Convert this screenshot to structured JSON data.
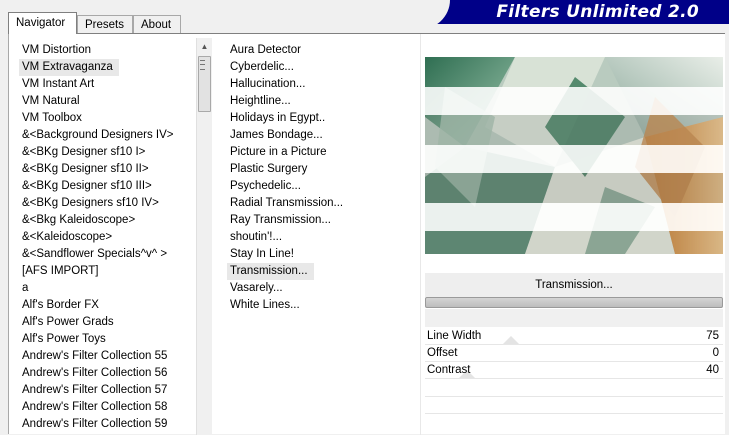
{
  "tabs": [
    {
      "label": "Navigator",
      "active": true
    },
    {
      "label": "Presets",
      "active": false
    },
    {
      "label": "About",
      "active": false
    }
  ],
  "banner": {
    "title": "Filters Unlimited 2.0",
    "color": "#000088"
  },
  "categories": {
    "selected_index": 1,
    "items": [
      "VM Distortion",
      "VM Extravaganza",
      "VM Instant Art",
      "VM Natural",
      "VM Toolbox",
      "&<Background Designers IV>",
      "&<BKg Designer sf10 I>",
      "&<BKg Designer sf10 II>",
      "&<BKg Designer sf10 III>",
      "&<BKg Designers sf10 IV>",
      "&<Bkg Kaleidoscope>",
      "&<Kaleidoscope>",
      "&<Sandflower Specials^v^ >",
      "[AFS IMPORT]",
      "a",
      "Alf's Border FX",
      "Alf's Power Grads",
      "Alf's Power Toys",
      "Andrew's Filter Collection 55",
      "Andrew's Filter Collection 56",
      "Andrew's Filter Collection 57",
      "Andrew's Filter Collection 58",
      "Andrew's Filter Collection 59"
    ]
  },
  "filters": {
    "selected_index": 13,
    "items": [
      " Aura Detector",
      "Cyberdelic...",
      "Hallucination...",
      "Heightline...",
      "Holidays in Egypt..",
      "James Bondage...",
      "Picture in a Picture",
      "Plastic Surgery",
      "Psychedelic...",
      "Radial Transmission...",
      "Ray Transmission...",
      "shoutin'!...",
      "Stay In Line!",
      "Transmission...",
      "Vasarely...",
      "White Lines..."
    ]
  },
  "action_button": {
    "label": "Transmission..."
  },
  "params": [
    {
      "label": "Line Width",
      "value": "75"
    },
    {
      "label": "Offset",
      "value": "0"
    },
    {
      "label": "Contrast",
      "value": "40"
    }
  ],
  "icons": {
    "scroll_up": "▲"
  }
}
